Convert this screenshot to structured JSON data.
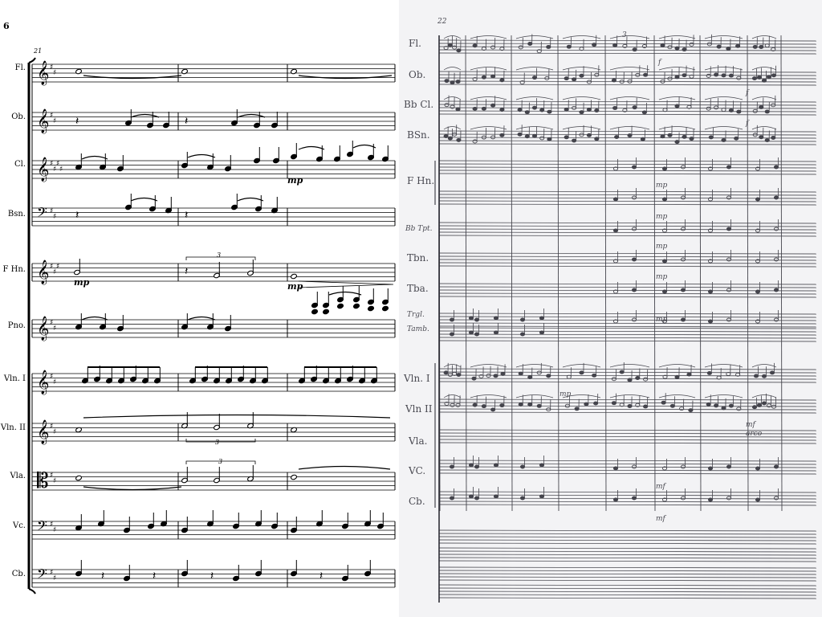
{
  "left_page": {
    "page_number": "6",
    "measure_number": "21",
    "instruments": [
      "Fl.",
      "Ob.",
      "Cl.",
      "Bsn.",
      "F Hn.",
      "Pno.",
      "Vln. I",
      "Vln. II",
      "Vla.",
      "Vc.",
      "Cb."
    ],
    "dynamics": {
      "clarinet": "mp",
      "horn_1": "mp",
      "horn_2": "mp"
    },
    "tuplet_marks": [
      "3",
      "3",
      "3"
    ]
  },
  "right_page": {
    "measure_number": "22",
    "instruments": [
      "Fl.",
      "Ob.",
      "Bb Cl.",
      "BSn.",
      "F Hn.",
      "Bb Tpt.",
      "Tbn.",
      "Tba.",
      "Trgl.",
      "Tamb.",
      "Vln. I",
      "Vln II",
      "Vla.",
      "VC.",
      "Cb."
    ],
    "marks": {
      "mp": "mp",
      "mf": "mf",
      "f": "f",
      "arco": "arco",
      "three": "3"
    }
  },
  "colors": {
    "page_bg": "#ffffff",
    "paper_bg": "#f3f3f5",
    "ink": "#000000",
    "pencil": "#4a4a52"
  }
}
